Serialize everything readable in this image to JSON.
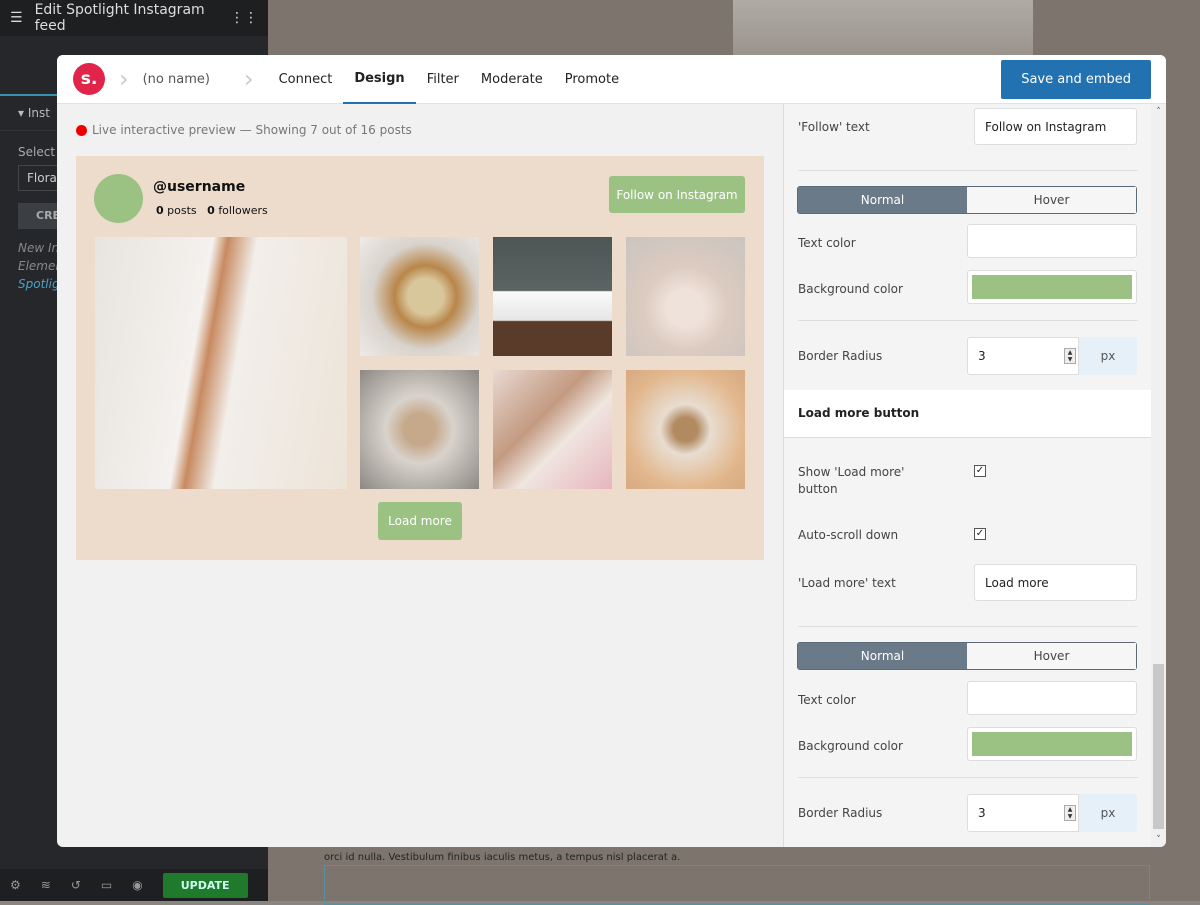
{
  "editor": {
    "title": "Edit Spotlight Instagram feed",
    "section": "Inst",
    "select_label": "Select t one",
    "select_value": "Floral",
    "create_btn": "CRE",
    "links": [
      "New In",
      "Elemen",
      "Spotlig"
    ],
    "update": "UPDATE"
  },
  "page": {
    "body_text": "orci id nulla. Vestibulum finibus iaculis metus, a tempus nisl placerat a."
  },
  "modal": {
    "logo": "s.",
    "feed_name": "(no name)",
    "nav": [
      {
        "label": "Connect",
        "active": false
      },
      {
        "label": "Design",
        "active": true
      },
      {
        "label": "Filter",
        "active": false
      },
      {
        "label": "Moderate",
        "active": false
      },
      {
        "label": "Promote",
        "active": false
      }
    ],
    "save": "Save and embed",
    "preview": {
      "status": "Live interactive preview — Showing 7 out of 16 posts",
      "username": "@username",
      "posts": "0",
      "posts_label": "posts",
      "followers": "0",
      "followers_label": "followers",
      "follow_btn": "Follow on Instagram",
      "load_more": "Load more"
    },
    "panel": {
      "follow_text_label": "'Follow' text",
      "follow_text_value": "Follow on Instagram",
      "normal": "Normal",
      "hover": "Hover",
      "text_color": "Text color",
      "bg_color": "Background color",
      "border_radius": "Border Radius",
      "radius_value": "3",
      "unit": "px",
      "load_more_section": "Load more button",
      "show_load_more": "Show 'Load more' button",
      "auto_scroll": "Auto-scroll down",
      "load_more_text_label": "'Load more' text",
      "load_more_text_value": "Load more",
      "accent": "#9bc283"
    }
  }
}
